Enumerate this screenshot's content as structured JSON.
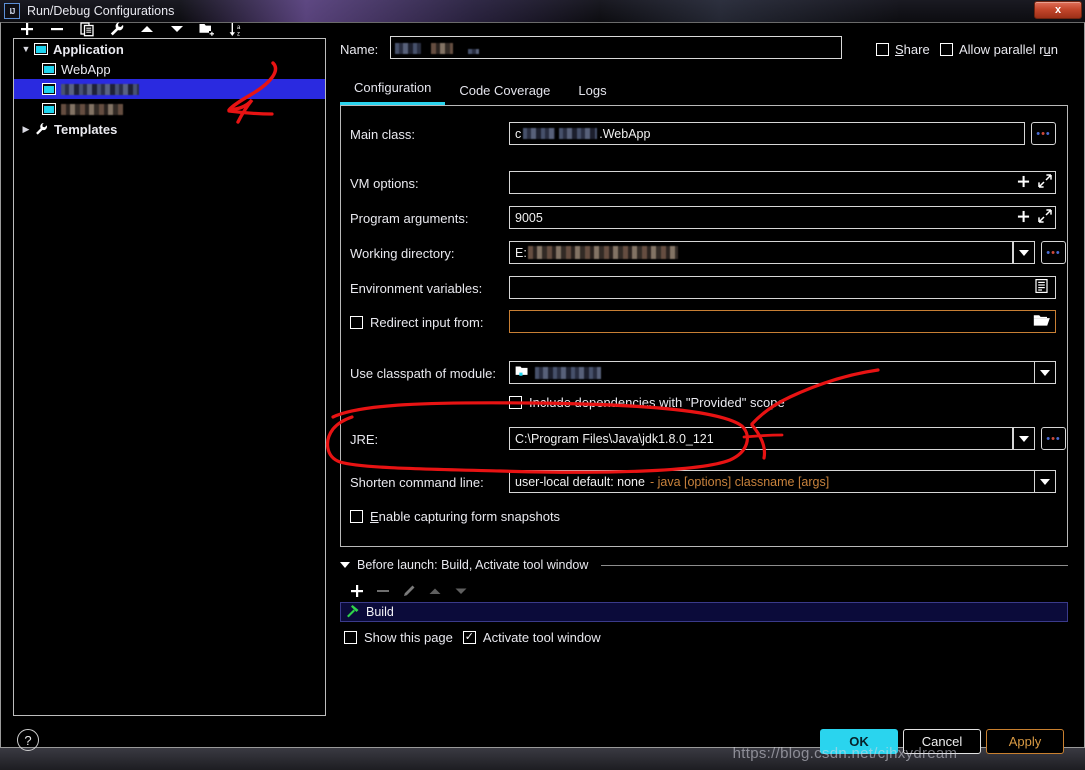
{
  "window": {
    "title": "Run/Debug Configurations",
    "app_icon": "intellij-idea-icon",
    "close_label": "x"
  },
  "left_toolbar": {
    "buttons": [
      {
        "name": "add-configuration-button",
        "glyph": "+"
      },
      {
        "name": "remove-configuration-button",
        "glyph": "−"
      },
      {
        "name": "copy-configuration-button",
        "glyph": "copy-icon"
      },
      {
        "name": "edit-templates-button",
        "glyph": "wrench-icon"
      },
      {
        "name": "move-up-button",
        "glyph": "triangle-up-icon"
      },
      {
        "name": "move-down-button",
        "glyph": "triangle-down-icon"
      },
      {
        "name": "create-folder-button",
        "glyph": "folder-add-icon"
      },
      {
        "name": "sort-configurations-button",
        "glyph": "sort-az-icon"
      }
    ]
  },
  "tree": {
    "items": [
      {
        "label": "Application",
        "icon": "application-icon",
        "expanded": true,
        "level": 0,
        "bold": true,
        "selected": false,
        "redacted": false
      },
      {
        "label": "WebApp",
        "icon": "application-icon",
        "level": 1,
        "bold": false,
        "selected": false,
        "redacted": false
      },
      {
        "label": "",
        "icon": "application-icon",
        "level": 1,
        "bold": false,
        "selected": true,
        "redacted": true,
        "redact_width": 78
      },
      {
        "label": "",
        "icon": "application-icon",
        "level": 1,
        "bold": false,
        "selected": false,
        "redacted": true,
        "redact_width": 62
      },
      {
        "label": "Templates",
        "icon": "wrench-icon",
        "expanded": false,
        "level": 0,
        "bold": true,
        "selected": false,
        "redacted": false
      }
    ]
  },
  "header": {
    "name_label": "Name:",
    "name_value": "",
    "name_redacted": true,
    "share_label": "Share",
    "share_checked": false,
    "parallel_label": "Allow parallel run",
    "parallel_checked": false
  },
  "tabs": [
    {
      "label": "Configuration",
      "active": true
    },
    {
      "label": "Code Coverage",
      "active": false
    },
    {
      "label": "Logs",
      "active": false
    }
  ],
  "fields": {
    "main_class_label": "Main class:",
    "main_class_value_prefix": "c",
    "main_class_value_suffix": ".WebApp",
    "vm_options_label": "VM options:",
    "vm_options_value": "",
    "program_arguments_label": "Program arguments:",
    "program_arguments_value": "9005",
    "working_directory_label": "Working directory:",
    "working_directory_value_prefix": "E:",
    "environment_variables_label": "Environment variables:",
    "environment_variables_value": "",
    "redirect_input_label": "Redirect input from:",
    "redirect_input_checked": false,
    "redirect_input_value": "",
    "classpath_label": "Use classpath of module:",
    "classpath_value": "",
    "include_provided_label": "Include dependencies with \"Provided\" scope",
    "include_provided_checked": false,
    "jre_label": "JRE:",
    "jre_value": "C:\\Program Files\\Java\\jdk1.8.0_121",
    "shorten_label": "Shorten command line:",
    "shorten_value": "user-local default: none",
    "shorten_value_hint": "- java [options] classname [args]",
    "snapshots_label": "Enable capturing form snapshots",
    "snapshots_checked": false
  },
  "before_launch": {
    "header": "Before launch: Build, Activate tool window",
    "toolbar": [
      {
        "name": "add-task-button",
        "glyph": "+",
        "enabled": true
      },
      {
        "name": "remove-task-button",
        "glyph": "−",
        "enabled": false
      },
      {
        "name": "edit-task-button",
        "glyph": "pencil-icon",
        "enabled": false
      },
      {
        "name": "move-task-up-button",
        "glyph": "triangle-up-icon",
        "enabled": false
      },
      {
        "name": "move-task-down-button",
        "glyph": "triangle-down-icon",
        "enabled": false
      }
    ],
    "tasks": [
      {
        "label": "Build",
        "icon": "build-hammer-icon"
      }
    ],
    "show_page_label": "Show this page",
    "show_page_checked": false,
    "activate_window_label": "Activate tool window",
    "activate_window_checked": true
  },
  "footer": {
    "help_label": "?",
    "ok_label": "OK",
    "cancel_label": "Cancel",
    "apply_label": "Apply"
  },
  "watermark": "https://blog.csdn.net/cjhxydream",
  "colors": {
    "accent_cyan": "#2ad4ee",
    "selection_blue": "#2a2ae0",
    "annotation_red": "#e81313",
    "apply_orange": "#c9802f"
  }
}
